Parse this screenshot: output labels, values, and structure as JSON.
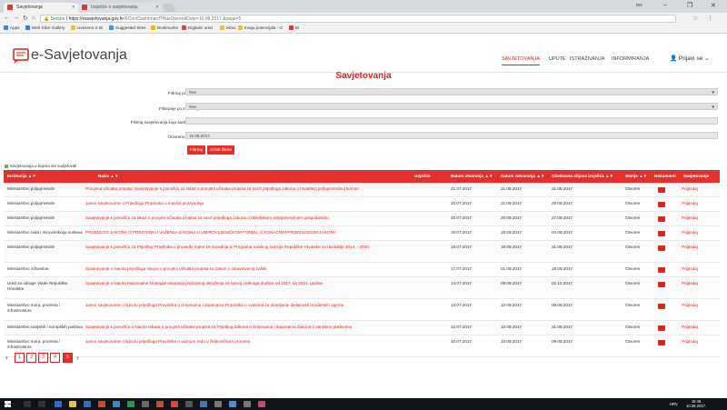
{
  "browser": {
    "tabs": [
      {
        "label": "Savjetovanja"
      },
      {
        "label": "Izvješće o savjetovanju"
      }
    ],
    "user_chip": "tes",
    "window_controls": {
      "min": "–",
      "max": "❐",
      "close": "✕"
    },
    "url": {
      "secure_label": "Secure",
      "host": "https://esavjetovanja.gov.hr",
      "path": "/ECon/Dashboard?HasOpenedDate=10.08.2017.&page=5"
    },
    "bookmarks": [
      {
        "label": "Apps",
        "color": "#4a7fd6"
      },
      {
        "label": "Web Slice Gallery",
        "color": "#3a7bd5"
      },
      {
        "label": "Uvezeno iz IE",
        "color": "#e8c14a"
      },
      {
        "label": "Suggested Sites",
        "color": "#3a9bd5"
      },
      {
        "label": "Bookmarks",
        "color": "#e8b923"
      },
      {
        "label": "Digitalni ured",
        "color": "#d14b4b"
      },
      {
        "label": "eDoc",
        "color": "#e8c14a"
      },
      {
        "label": "Imaju potencijala - O",
        "color": "#e8c14a"
      },
      {
        "label": "M",
        "color": "#d63a3a"
      }
    ]
  },
  "site": {
    "logo_text": "e-Savjetovanja",
    "nav": [
      {
        "label": "SAVJETOVANJA",
        "active": true
      },
      {
        "label": "UPUTE",
        "active": false
      },
      {
        "label": "ISTRAŽIVANJA",
        "active": false
      },
      {
        "label": "INFORMIRANJA",
        "active": false
      }
    ],
    "login": "Prijavi se",
    "accent_color": "#d9261c"
  },
  "page_title": "Savjetovanja",
  "filters": {
    "status_label": "Filtriraj po stanju:",
    "status_value": "Sve",
    "institution_label": "Filtriranje po instituciji:",
    "institution_value": "Sve",
    "keyword_label": "Filtriraj savjetovanja koja sadrže riječ:",
    "keyword_value": "",
    "date_label": "Otvoreno na dan:",
    "date_value": "10.08.2017.",
    "filter_button": "Filtriraj",
    "clear_button": "Očisti filtere"
  },
  "legend": "Savjetovanja u kojima ste sudjelovali",
  "table": {
    "headers": {
      "institution": "Institucija",
      "name": "Naziv",
      "report": "Izvješće",
      "opened": "Datum otvaranja",
      "closed": "Datum zatvaranja",
      "expected": "Očekivana objava izvješća",
      "status": "Stanje",
      "documents": "Dokumenti",
      "consultations": "Savjetovanje"
    },
    "sort_mark": "▲▼",
    "rows": [
      {
        "institution": "Ministarstvo poljoprivrede",
        "name": "Procjena učinaka propisa: Savjetovanje s javnošću za Iskaz o procjeni učinaka propisa za nacrt prijedloga zakona o hrvatskoj poljoprivrednoj komori",
        "opened": "21.07.2017.",
        "closed": "21.08.2017.",
        "expected": "31.08.2017.",
        "status": "Otvoren",
        "view": "Pogledaj"
      },
      {
        "institution": "Ministarstvo poljoprivrede",
        "name": "Javno savjetovanje o Prijedlogu Pravilnika o maslini proizvodnja",
        "opened": "20.07.2017.",
        "closed": "21.08.2017.",
        "expected": "29.08.2017.",
        "status": "Otvoren",
        "view": "Pogledaj"
      },
      {
        "institution": "Ministarstvo poljoprivrede",
        "name": "Savjetovanje s javnošću za Iskaz o procjeni učinaka propisa za nacrt prijedloga zakona o obiteljskom poljoprivrednom gospodarstvu",
        "opened": "20.07.2017.",
        "closed": "20.08.2017.",
        "expected": "27.08.2017.",
        "status": "Otvoren",
        "view": "Pogledaj"
      },
      {
        "institution": "Ministarstvo rada i mirovinskoga sustava",
        "name": "PRIJEDLOG ZAKONA O PRESTANKU VAŽENJA ZAKONA O UMIROVLJENIČKOM FONDU, S KONAČNIM PRIJEDLOGOM ZAKONA",
        "opened": "19.07.2017.",
        "closed": "18.08.2017.",
        "expected": "04.09.2017.",
        "status": "Otvoren",
        "view": "Pogledaj"
      },
      {
        "institution": "Ministarstvo poljoprivrede",
        "name": "Savjetovanje s javnošću za Prijedlog Pravilnika o provedbi mjere 16 Suradnja iz Programa ruralnog razvoja Republike Hrvatske za razdoblje 2014. - 2020.",
        "opened": "18.07.2017.",
        "closed": "18.08.2017.",
        "expected": "31.08.2017.",
        "status": "Otvoren",
        "view": "Pogledaj",
        "tall": true
      },
      {
        "institution": "Ministarstvo zdravstva",
        "name": "Savjetovanje o Nacrtu prijedloga Iskaza o procjeni učinaka propisa za Zakon o zdravstvenoj zaštiti",
        "opened": "17.07.2017.",
        "closed": "01.09.2017.",
        "expected": "18.09.2017.",
        "status": "Otvoren",
        "view": "Pogledaj"
      },
      {
        "institution": "Ured za udruge Vlade Republike Hrvatske",
        "name": "Savjetovanje o Nacrtu Nacionalne strategije stvaranja poticajnog okruženja za razvoj civilnoga društva od 2017. do 2021. godine",
        "opened": "14.07.2017.",
        "closed": "08.08.2017.",
        "expected": "02.10.2017.",
        "status": "Otvoren",
        "view": "Pogledaj",
        "tall": true
      },
      {
        "institution": "Ministarstvo mora, prometa i infrastrukture",
        "name": "Javno savjetovanje o Nacrtu prijedloga Pravilnika o izmjenama i dopunama Pravilnika o uvjetima za obavljanje djelatnosti brodarskih agenta",
        "opened": "13.07.2017.",
        "closed": "12.08.2017.",
        "expected": "08.08.2017.",
        "status": "Otvoren",
        "view": "Pogledaj",
        "tall": true
      },
      {
        "institution": "Ministarstvo vanjskih i europskih poslova",
        "name": "Savjetovanje s javnošću o Nacrtu Iskaza o procjeni učinaka propisa za Prijedlog Zakona o izmjenama i dopunama Zakona o vanjskim poslovima",
        "opened": "12.07.2017.",
        "closed": "12.08.2017.",
        "expected": "31.08.2017.",
        "status": "Otvoren",
        "view": "Pogledaj"
      },
      {
        "institution": "Ministarstvo mora, prometa i infrastrukture",
        "name": "Javno savjetovanje o Nacrtu prijedloga Pravilnika o voznom redu u željezničkom prometu",
        "opened": "10.07.2017.",
        "closed": "10.08.2017.",
        "expected": "09.08.2017.",
        "status": "Otvoren",
        "view": "Pogledaj",
        "tall": true
      }
    ]
  },
  "pagination": {
    "prev": "‹",
    "next": "›",
    "pages": [
      "1",
      "2",
      "3",
      "4",
      "5"
    ],
    "current": "5"
  },
  "taskbar": {
    "lang": "HRV",
    "time": "15:45",
    "date": "10.08.2017."
  }
}
